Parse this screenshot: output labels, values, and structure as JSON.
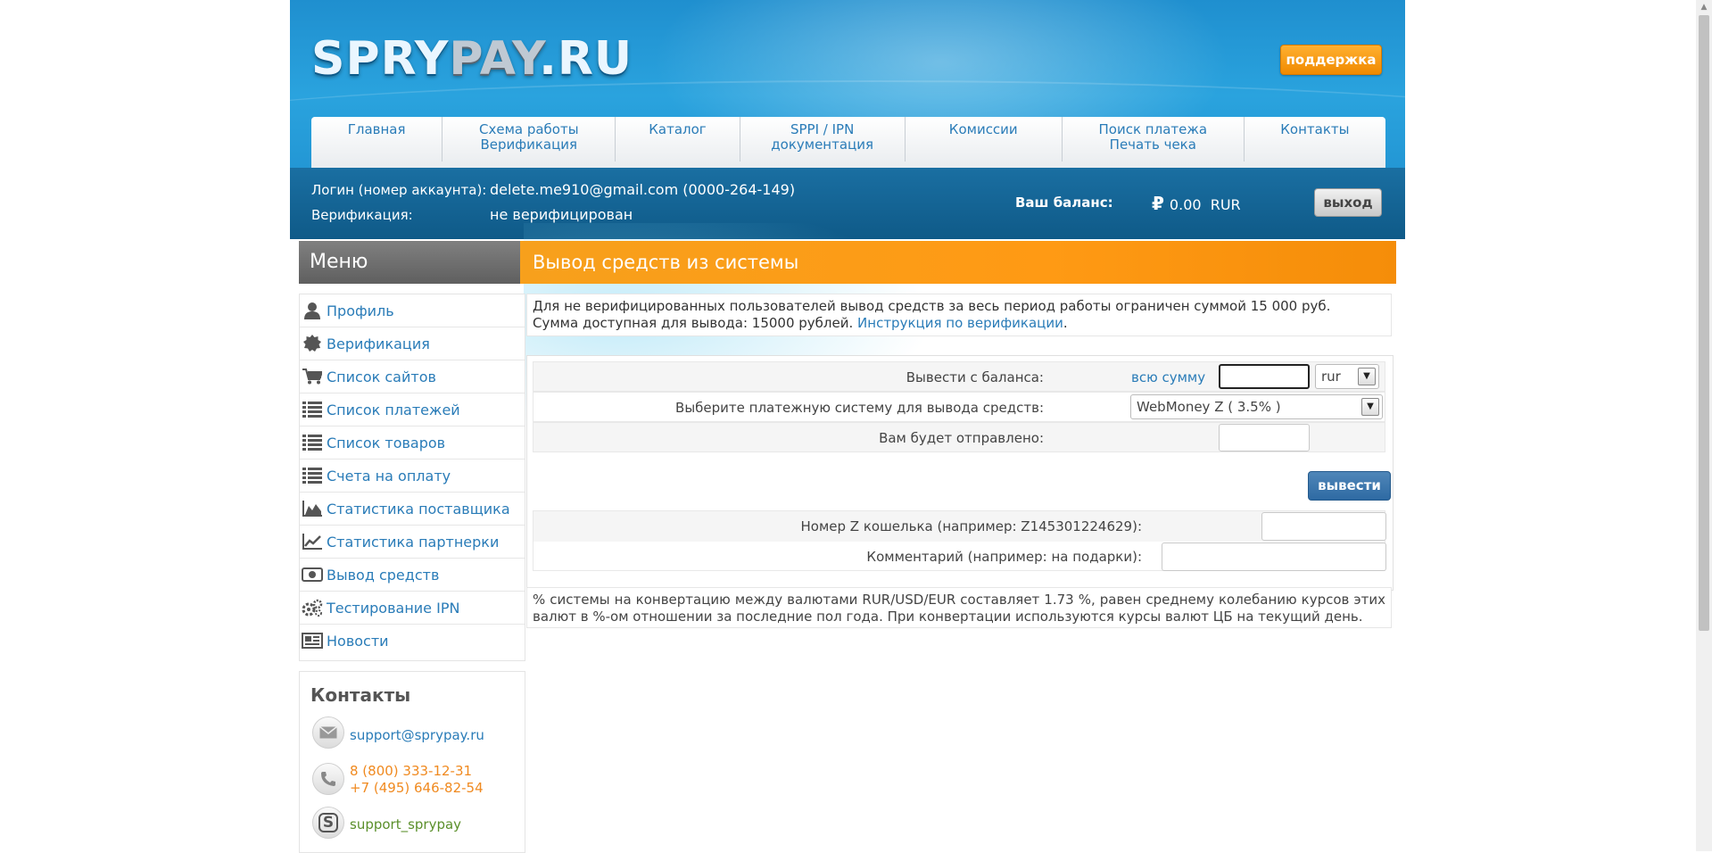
{
  "header": {
    "logo": {
      "part1": "SPRY",
      "part2": "PAY",
      "part3": ".RU"
    },
    "support_label": "поддержка"
  },
  "nav": [
    {
      "line1": "Главная",
      "line2": ""
    },
    {
      "line1": "Схема работы",
      "line2": "Верификация"
    },
    {
      "line1": "Каталог",
      "line2": ""
    },
    {
      "line1": "SPPI / IPN",
      "line2": "документация"
    },
    {
      "line1": "Комиссии",
      "line2": ""
    },
    {
      "line1": "Поиск платежа",
      "line2": "Печать чека"
    },
    {
      "line1": "Контакты",
      "line2": ""
    }
  ],
  "account": {
    "login_label": "Логин (номер аккаунта):",
    "login_value": "delete.me910@gmail.com (0000-264-149)",
    "verification_label": "Верификация:",
    "verification_value": "не верифицирован",
    "balance_label": "Ваш баланс:",
    "balance_value": "0.00",
    "currency": "RUR",
    "logout_label": "выход"
  },
  "sidebar": {
    "title": "Меню",
    "items": [
      {
        "label": "Профиль",
        "icon": "user-icon"
      },
      {
        "label": "Верификация",
        "icon": "badge-icon"
      },
      {
        "label": "Список сайтов",
        "icon": "cart-icon"
      },
      {
        "label": "Список платежей",
        "icon": "list-icon"
      },
      {
        "label": "Список товаров",
        "icon": "list-icon"
      },
      {
        "label": "Счета на оплату",
        "icon": "list-icon"
      },
      {
        "label": "Статистика поставщика",
        "icon": "area-chart-icon"
      },
      {
        "label": "Статистика партнерки",
        "icon": "line-chart-icon"
      },
      {
        "label": "Вывод средств",
        "icon": "banknote-icon"
      },
      {
        "label": "Тестирование IPN",
        "icon": "gears-icon"
      },
      {
        "label": "Новости",
        "icon": "newspaper-icon"
      }
    ]
  },
  "contacts": {
    "title": "Контакты",
    "email": "support@sprypay.ru",
    "phone1": "8 (800) 333-12-31",
    "phone2": "+7 (495) 646-82-54",
    "skype": "support_sprypay"
  },
  "main": {
    "title": "Вывод средств из системы",
    "info_line1": "Для не верифицированных пользователей вывод средств за весь период работы ограничен суммой 15 000 руб.",
    "info_line2_text": "Сумма доступная для вывода: 15000 рублей.",
    "info_link": "Инструкция по верификации",
    "info_dot": ".",
    "form": {
      "withdraw_label": "Вывести с баланса:",
      "all_sum_link": "всю сумму",
      "amount_value": "",
      "currency_selected": "rur",
      "system_label": "Выберите платежную систему для вывода средств:",
      "system_selected": "WebMoney Z (  3.5%  )",
      "sent_label": "Вам будет отправлено:",
      "sent_value": "",
      "submit_label": "вывести",
      "wallet_label": "Номер Z кошелька (например: Z145301224629):",
      "wallet_value": "",
      "comment_label": "Комментарий (например: на подарки):",
      "comment_value": ""
    },
    "note": "% системы на конвертацию между валютами RUR/USD/EUR составляет 1.73 %, равен среднему колебанию курсов этих валют в %-ом отношении за последние пол года. При конвертации используются курсы валют ЦБ на текущий день."
  },
  "colors": {
    "header_blue": "#1f8fcf",
    "account_bar": "#0f5a88",
    "orange": "#f7a01c",
    "link": "#2a7cb8",
    "phone": "#f08a20",
    "skype": "#5a8f2a"
  }
}
